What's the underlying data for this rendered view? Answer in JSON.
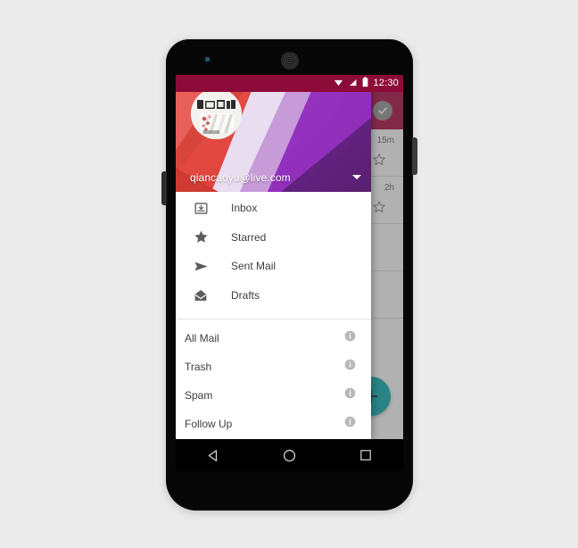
{
  "page": {
    "background_color": "#ebebeb"
  },
  "device": {
    "name": "android-phone-mockup",
    "frame_color": "#070707",
    "hardware": {
      "earpiece": "speaker-grille",
      "sensor": "proximity-sensor",
      "power_button": "power-button",
      "volume_button": "volume-button"
    }
  },
  "status_bar": {
    "time": "12:30",
    "background_color": "#8c0b39",
    "icons": [
      "wifi-icon",
      "signal-icon",
      "battery-icon"
    ]
  },
  "app_bar": {
    "background_color": "#b0154b",
    "check_icon": "check-circle-icon"
  },
  "mail_list": {
    "rows": [
      {
        "time": "15m",
        "starred": false
      },
      {
        "time": "2h",
        "starred": false
      }
    ],
    "star_icon": "star-outline-icon"
  },
  "fab": {
    "label": "+",
    "icon": "plus-icon",
    "color": "#14b2b2"
  },
  "drawer": {
    "account": {
      "email": "qiancaoyu@live.com",
      "avatar": "user-avatar",
      "switcher_icon": "chevron-down-icon"
    },
    "primary_items": [
      {
        "label": "Inbox",
        "icon": "inbox-icon"
      },
      {
        "label": "Starred",
        "icon": "star-icon"
      },
      {
        "label": "Sent Mail",
        "icon": "send-icon"
      },
      {
        "label": "Drafts",
        "icon": "drafts-icon"
      }
    ],
    "secondary_items": [
      {
        "label": "All Mail",
        "icon": "info-icon"
      },
      {
        "label": "Trash",
        "icon": "info-icon"
      },
      {
        "label": "Spam",
        "icon": "info-icon"
      },
      {
        "label": "Follow Up",
        "icon": "info-icon"
      }
    ]
  },
  "navigation_bar": {
    "buttons": [
      {
        "name": "back-button",
        "icon": "triangle-back-icon"
      },
      {
        "name": "home-button",
        "icon": "circle-home-icon"
      },
      {
        "name": "recents-button",
        "icon": "square-recents-icon"
      }
    ]
  }
}
